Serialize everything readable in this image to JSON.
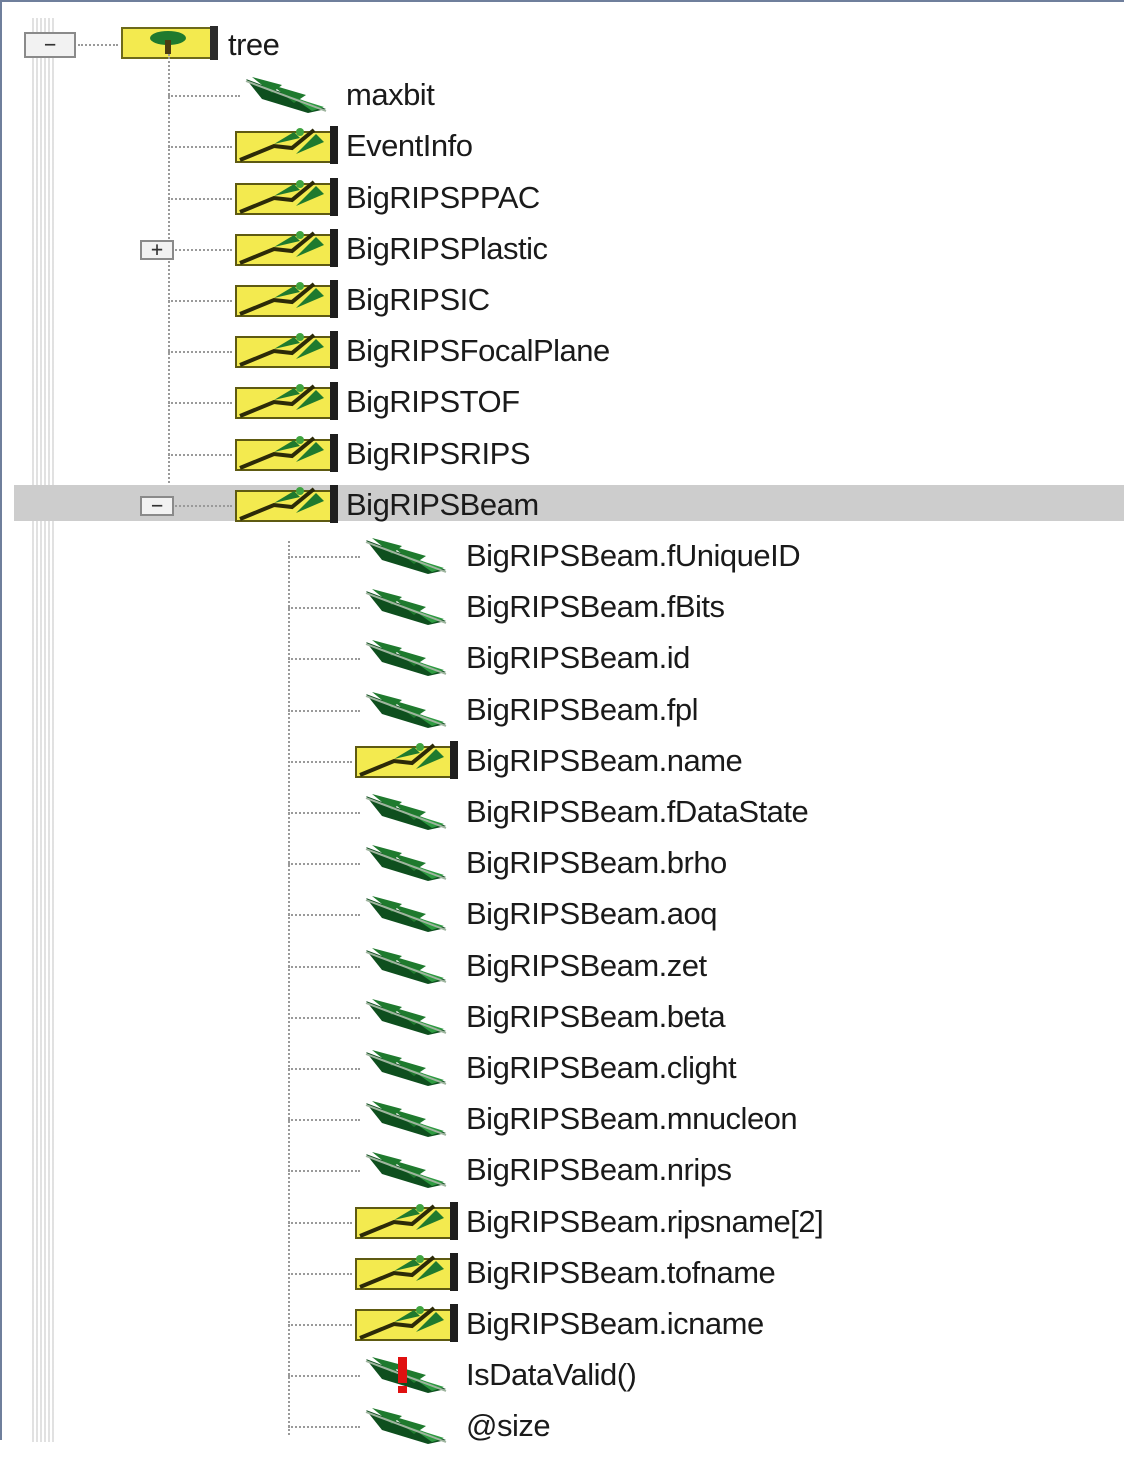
{
  "tree": {
    "root": {
      "label": "tree",
      "icon": "tree-icon",
      "expanded": true
    },
    "nodes": [
      {
        "id": "maxbit",
        "label": "maxbit",
        "icon": "leaf-icon",
        "depth": 1
      },
      {
        "id": "eventinfo",
        "label": "EventInfo",
        "icon": "branch-folder-icon",
        "depth": 1
      },
      {
        "id": "bigripsppac",
        "label": "BigRIPSPPAC",
        "icon": "branch-folder-icon",
        "depth": 1
      },
      {
        "id": "bigripsplastic",
        "label": "BigRIPSPlastic",
        "icon": "branch-folder-icon",
        "depth": 1,
        "expander": "+"
      },
      {
        "id": "bigripsic",
        "label": "BigRIPSIC",
        "icon": "branch-folder-icon",
        "depth": 1
      },
      {
        "id": "bigripsfocalplane",
        "label": "BigRIPSFocalPlane",
        "icon": "branch-folder-icon",
        "depth": 1
      },
      {
        "id": "bigripstof",
        "label": "BigRIPSTOF",
        "icon": "branch-folder-icon",
        "depth": 1
      },
      {
        "id": "bigripsrips",
        "label": "BigRIPSRIPS",
        "icon": "branch-folder-icon",
        "depth": 1
      },
      {
        "id": "bigripsbeam",
        "label": "BigRIPSBeam",
        "icon": "branch-folder-icon",
        "depth": 1,
        "expander": "−",
        "selected": true
      },
      {
        "id": "funiqueid",
        "label": "BigRIPSBeam.fUniqueID",
        "icon": "leaf-icon",
        "depth": 2
      },
      {
        "id": "fbits",
        "label": "BigRIPSBeam.fBits",
        "icon": "leaf-icon",
        "depth": 2
      },
      {
        "id": "id",
        "label": "BigRIPSBeam.id",
        "icon": "leaf-icon",
        "depth": 2
      },
      {
        "id": "fpl",
        "label": "BigRIPSBeam.fpl",
        "icon": "leaf-icon",
        "depth": 2
      },
      {
        "id": "name",
        "label": "BigRIPSBeam.name",
        "icon": "branch-folder-icon",
        "depth": 2
      },
      {
        "id": "fdatastate",
        "label": "BigRIPSBeam.fDataState",
        "icon": "leaf-icon",
        "depth": 2
      },
      {
        "id": "brho",
        "label": "BigRIPSBeam.brho",
        "icon": "leaf-icon",
        "depth": 2
      },
      {
        "id": "aoq",
        "label": "BigRIPSBeam.aoq",
        "icon": "leaf-icon",
        "depth": 2
      },
      {
        "id": "zet",
        "label": "BigRIPSBeam.zet",
        "icon": "leaf-icon",
        "depth": 2
      },
      {
        "id": "beta",
        "label": "BigRIPSBeam.beta",
        "icon": "leaf-icon",
        "depth": 2
      },
      {
        "id": "clight",
        "label": "BigRIPSBeam.clight",
        "icon": "leaf-icon",
        "depth": 2
      },
      {
        "id": "mnucleon",
        "label": "BigRIPSBeam.mnucleon",
        "icon": "leaf-icon",
        "depth": 2
      },
      {
        "id": "nrips",
        "label": "BigRIPSBeam.nrips",
        "icon": "leaf-icon",
        "depth": 2
      },
      {
        "id": "ripsname",
        "label": "BigRIPSBeam.ripsname[2]",
        "icon": "branch-folder-icon",
        "depth": 2
      },
      {
        "id": "tofname",
        "label": "BigRIPSBeam.tofname",
        "icon": "branch-folder-icon",
        "depth": 2
      },
      {
        "id": "icname",
        "label": "BigRIPSBeam.icname",
        "icon": "branch-folder-icon",
        "depth": 2
      },
      {
        "id": "isdatavalid",
        "label": "IsDataValid()",
        "icon": "leaf-function-icon",
        "depth": 2
      },
      {
        "id": "size",
        "label": "@size",
        "icon": "leaf-icon",
        "depth": 2
      }
    ]
  },
  "colors": {
    "selection": "#cdcdcd",
    "folder_yellow": "#f3ea4f",
    "leaf_green": "#1f7a2e",
    "leaf_dark": "#0e4f1e",
    "function_red": "#e01010"
  }
}
